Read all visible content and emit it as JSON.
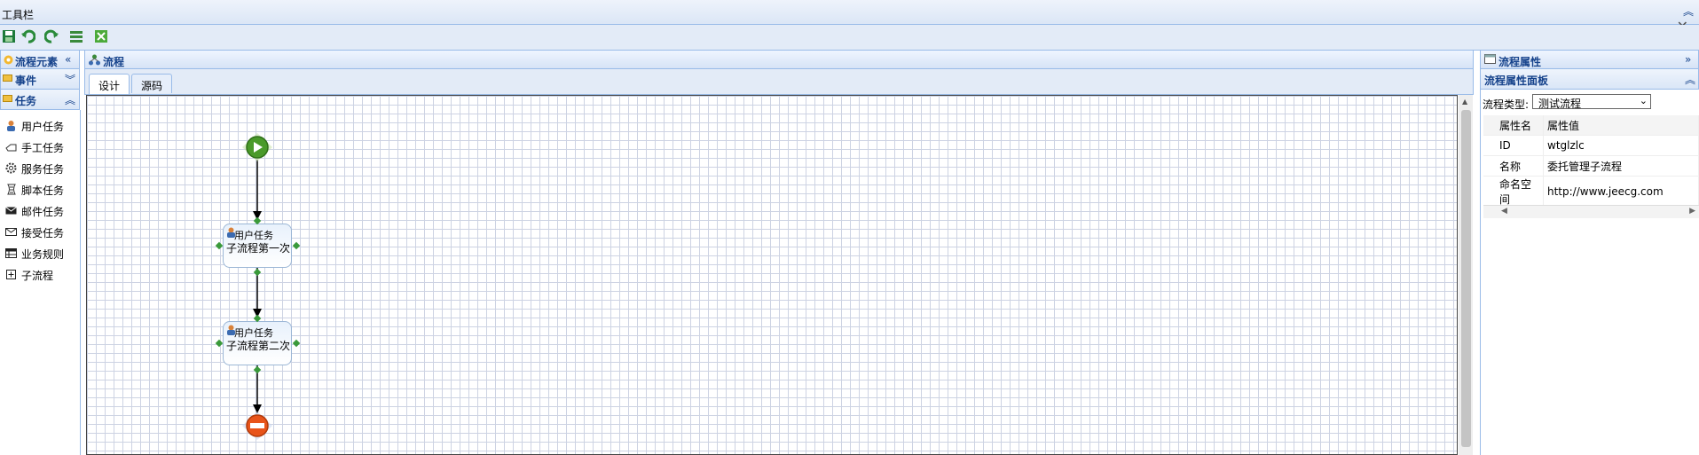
{
  "toolbar": {
    "title": "工具栏",
    "buttons": [
      {
        "icon": "save-icon"
      },
      {
        "icon": "undo-icon"
      },
      {
        "icon": "redo-icon"
      },
      {
        "icon": "list-icon"
      },
      {
        "icon": "close-box-icon"
      }
    ]
  },
  "left_panel": {
    "title": "流程元素",
    "sections": [
      {
        "label": "事件"
      },
      {
        "label": "任务"
      }
    ],
    "task_items": [
      {
        "label": "用户任务",
        "icon": "user-icon"
      },
      {
        "label": "手工任务",
        "icon": "hand-icon"
      },
      {
        "label": "服务任务",
        "icon": "gear-icon"
      },
      {
        "label": "脚本任务",
        "icon": "script-icon"
      },
      {
        "label": "邮件任务",
        "icon": "mail-icon"
      },
      {
        "label": "接受任务",
        "icon": "receive-icon"
      },
      {
        "label": "业务规则",
        "icon": "table-icon"
      },
      {
        "label": "子流程",
        "icon": "plus-box-icon"
      }
    ]
  },
  "center_panel": {
    "title": "流程",
    "tabs": [
      {
        "label": "设计",
        "active": true
      },
      {
        "label": "源码",
        "active": false
      }
    ],
    "diagram": {
      "nodes": [
        {
          "type": "start-event"
        },
        {
          "type": "user-task",
          "header": "用户任务",
          "name": "子流程第一次"
        },
        {
          "type": "user-task",
          "header": "用户任务",
          "name": "子流程第二次"
        },
        {
          "type": "end-event"
        }
      ]
    }
  },
  "right_panel": {
    "title": "流程属性",
    "subpanel_title": "流程属性面板",
    "type_label": "流程类型:",
    "type_value": "测试流程",
    "table_headers": [
      "属性名",
      "属性值"
    ],
    "rows": [
      {
        "name": "ID",
        "value": "wtglzlc"
      },
      {
        "name": "名称",
        "value": "委托管理子流程"
      },
      {
        "name": "命名空间",
        "value": "http://www.jeecg.com"
      }
    ]
  },
  "colors": {
    "border": "#99bbe8",
    "header_text": "#15428b",
    "start_event": "#4a9a2a",
    "end_event": "#e8541a"
  }
}
